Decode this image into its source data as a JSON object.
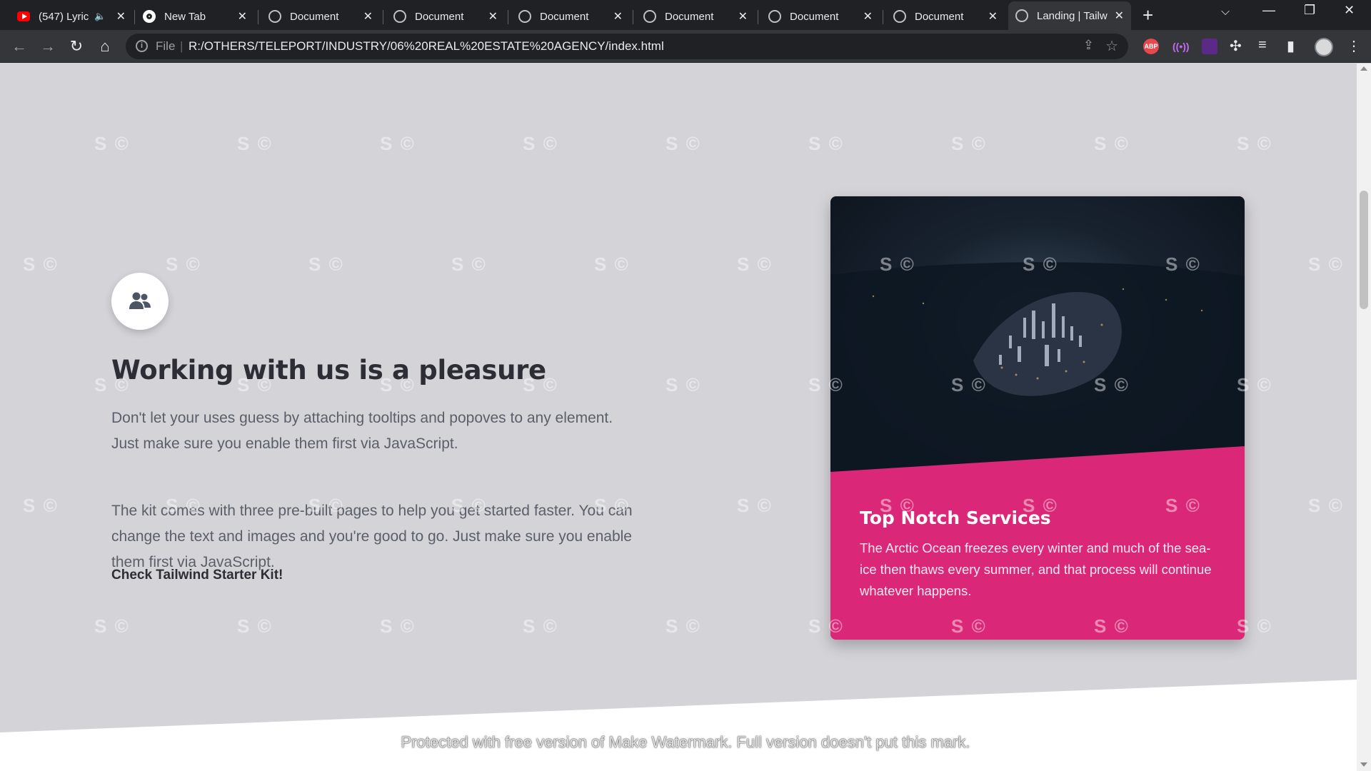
{
  "browser": {
    "tabs": [
      {
        "title": "(547) Lyric",
        "favicon": "youtube-icon",
        "audio": true
      },
      {
        "title": "New Tab",
        "favicon": "chrome-icon"
      },
      {
        "title": "Document",
        "favicon": "globe-icon"
      },
      {
        "title": "Document",
        "favicon": "globe-icon"
      },
      {
        "title": "Document",
        "favicon": "globe-icon"
      },
      {
        "title": "Document",
        "favicon": "globe-icon"
      },
      {
        "title": "Document",
        "favicon": "globe-icon"
      },
      {
        "title": "Document",
        "favicon": "globe-icon"
      },
      {
        "title": "Landing | Tailw",
        "favicon": "globe-icon",
        "active": true
      }
    ],
    "address": {
      "scheme": "File",
      "url": "R:/OTHERS/TELEPORT/INDUSTRY/06%20REAL%20ESTATE%20AGENCY/index.html"
    },
    "extensions": {
      "abp": "ABP"
    }
  },
  "content": {
    "heading": "Working with us is a pleasure",
    "paragraph1": "Don't let your uses guess by attaching tooltips and popoves to any element. Just make sure you enable them first via JavaScript.",
    "paragraph2": "The kit comes with three pre-built pages to help you get started faster. You can change the text and images and you're good to go. Just make sure you enable them first via JavaScript.",
    "cta": "Check Tailwind Starter Kit!",
    "feature_icon": "users-icon"
  },
  "card": {
    "title": "Top Notch Services",
    "text": "The Arctic Ocean freezes every winter and much of the sea-ice then thaws every summer, and that process will continue whatever happens.",
    "accent_color": "#db2777",
    "image": "night-city-aerial-photo"
  },
  "watermark": {
    "mark": "S ©",
    "banner": "Protected with free version of Make Watermark. Full version doesn't put this mark."
  },
  "colors": {
    "section_bg": "#d4d3d8",
    "heading": "#2d2d35",
    "body_text": "#5b5f69"
  }
}
